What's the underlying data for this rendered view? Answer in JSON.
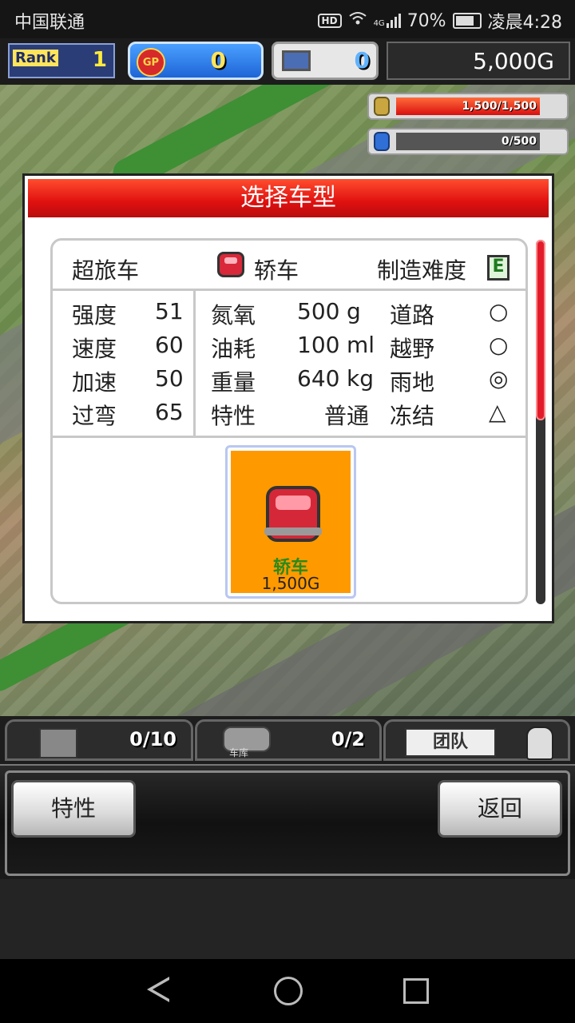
{
  "status_bar": {
    "carrier": "中国联通",
    "hd": "HD",
    "network": "4G",
    "battery": "70%",
    "time": "凌晨4:28"
  },
  "hud": {
    "rank_label": "Rank",
    "rank_value": "1",
    "gp_icon": "GP",
    "gp_value": "0",
    "pc_value": "0",
    "money": "5,000G",
    "resource1": {
      "text": "1,500/1,500",
      "fill": 1.0,
      "icon": "coin-stack-icon"
    },
    "resource2": {
      "text": "0/500",
      "fill": 0.0,
      "icon": "bottle-icon"
    }
  },
  "dialog": {
    "title": "选择车型",
    "category": "超旅车",
    "car_type": "轿车",
    "difficulty_label": "制造难度",
    "difficulty_value": "E",
    "stats": [
      {
        "label": "强度",
        "value": "51"
      },
      {
        "label": "速度",
        "value": "60"
      },
      {
        "label": "加速",
        "value": "50"
      },
      {
        "label": "过弯",
        "value": "65"
      }
    ],
    "specs": [
      {
        "label": "氮氧",
        "value": "500",
        "unit": "g"
      },
      {
        "label": "油耗",
        "value": "100",
        "unit": "ml"
      },
      {
        "label": "重量",
        "value": "640",
        "unit": "kg"
      },
      {
        "label": "特性",
        "value": "普通",
        "unit": ""
      }
    ],
    "terrain": [
      {
        "label": "道路",
        "mark": "○"
      },
      {
        "label": "越野",
        "mark": "○"
      },
      {
        "label": "雨地",
        "mark": "◎"
      },
      {
        "label": "冻结",
        "mark": "△"
      }
    ],
    "item": {
      "name": "轿车",
      "price": "1,500G"
    }
  },
  "tabs": {
    "parts_count": "0/10",
    "garage_label": "车库",
    "garage_count": "0/2",
    "team_label": "团队"
  },
  "buttons": {
    "traits": "特性",
    "back": "返回"
  }
}
